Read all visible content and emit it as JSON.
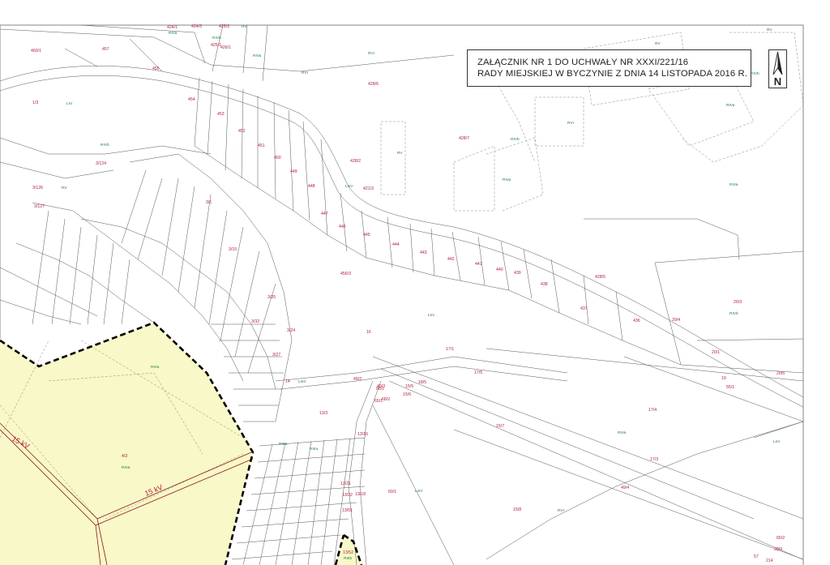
{
  "title": {
    "line1": "ZAŁĄCZNIK NR 1 DO UCHWAŁY NR XXXI/221/16",
    "line2": "RADY MIEJSKIEJ W BYCZYNIE Z DNIA 14 LISTOPADA 2016 R."
  },
  "north_arrow": {
    "letter": "N"
  },
  "colors": {
    "plot_number": "#b0203a",
    "land_use": "#1f7a3a",
    "area_fill": "#f8f8c8",
    "boundary": "#000000",
    "power_line": "#8b1a1a"
  },
  "power_line_labels": [
    "15 kV",
    "15 kV"
  ],
  "plot_numbers_major": [
    "424/1",
    "424/3",
    "425/3",
    "425/1",
    "426/1",
    "460/1",
    "457",
    "455",
    "454",
    "453",
    "452",
    "451",
    "450",
    "449",
    "448",
    "447",
    "446",
    "445",
    "444",
    "443",
    "442",
    "441",
    "440",
    "439",
    "438",
    "437",
    "436",
    "428/6",
    "428/7",
    "428/2",
    "428/5",
    "421/3",
    "456/3",
    "1/3",
    "16",
    "17/1",
    "17/5",
    "17/4",
    "17/3",
    "15/7",
    "15/8",
    "15/5",
    "15/6",
    "18/5",
    "20/3",
    "20/4",
    "20/1",
    "20/5",
    "19",
    "55/1",
    "49/2",
    "49/3",
    "49/4",
    "68/1",
    "68/2",
    "65/1",
    "60/1",
    "14",
    "13/3",
    "13/16",
    "13/21",
    "13/22",
    "13/18",
    "13/51",
    "13/52",
    "65/2",
    "57",
    "28/9",
    "214",
    "4/3",
    "3/1",
    "3/15",
    "3/25",
    "3/24",
    "3/32",
    "3/27",
    "3/124",
    "3/126",
    "3/127"
  ],
  "land_use_labels": [
    "RIVb",
    "RIVa",
    "RV",
    "RVI",
    "LIV",
    "RIIIa",
    "RIVa",
    "LsIII",
    "LsIV",
    "LsV",
    "RV",
    "RVI",
    "RIVb",
    "RV",
    "RIVa",
    "RVI",
    "RV",
    "RIVb",
    "RIVa",
    "RIVa",
    "RIVb",
    "RIIIb",
    "RV",
    "RIVa",
    "LsIV",
    "LsV",
    "RIVb",
    "RIVa",
    "RVI",
    "RIIIa",
    "RIVa"
  ]
}
